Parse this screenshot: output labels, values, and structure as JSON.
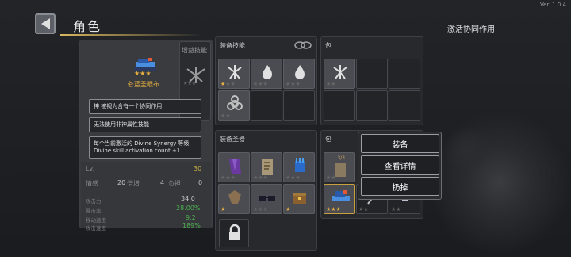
{
  "version": "Ver. 1.0.4",
  "header": {
    "title": "角色",
    "synergy_label": "激活协同作用"
  },
  "character": {
    "name": "苍蓝圣眼布",
    "sub_panel_title": "增益技能",
    "tooltip_1": "神 被视为含有一个协同作用",
    "tooltip_2": "无法使用非神属性技能",
    "tooltip_3": "每个当前激活的 Divine Synergy 等级, Divine skill activation count +1",
    "stars": 3,
    "level_label": "Lv.",
    "level_value": "30",
    "row2": {
      "a_label": "情感",
      "a_value": "20",
      "b_label": "倍增",
      "c_value": "4",
      "d_label": "负担",
      "e_value": "0"
    },
    "stats": [
      {
        "label": "攻击力",
        "value": "34.0",
        "color": "#c8c8c8"
      },
      {
        "label": "暴击率",
        "value": "28.00%",
        "color": "#4caf50"
      },
      {
        "label": "移动速度",
        "value": "9.2",
        "color": "#4caf50"
      },
      {
        "label": "攻击速度",
        "value": "189%",
        "color": "#4caf50"
      }
    ]
  },
  "equipped_skills": {
    "title": "装备技能",
    "slots": [
      {
        "icon": "dragon-skull-icon",
        "stars": 3
      },
      {
        "icon": "flame-icon",
        "stars": 3
      },
      {
        "icon": "flame-icon",
        "stars": 3
      },
      {
        "icon": "biohazard-icon",
        "stars": 2
      }
    ]
  },
  "skill_bag": {
    "title": "包",
    "slots": [
      {
        "icon": "dragon-skull-icon",
        "stars": 2
      }
    ]
  },
  "equipped_relics": {
    "title": "装备圣器",
    "slots": [
      {
        "icon": "purple-cloak-icon",
        "stars": 3
      },
      {
        "icon": "scroll-icon",
        "stars": 3
      },
      {
        "icon": "blue-gauntlet-icon",
        "stars": 3
      },
      {
        "icon": "bone-shield-icon",
        "stars": 1
      },
      {
        "icon": "sunglasses-icon",
        "stars": 3
      },
      {
        "icon": "treasure-chest-icon",
        "stars": 1
      }
    ]
  },
  "relic_bag": {
    "title": "包",
    "slots": [
      {
        "icon": "card-icon",
        "stars": 2,
        "count": "3/3"
      },
      {
        "icon": "rainbow-hat-icon",
        "stars": 3
      },
      {
        "icon": "feather-icon",
        "stars": 2
      },
      {
        "icon": "silver-badge-icon",
        "stars": 2
      }
    ]
  },
  "menu": {
    "equip": "装备",
    "details": "查看详情",
    "discard": "扔掉"
  },
  "colors": {
    "accent_gold": "#e8b040",
    "panel": "#28292e",
    "green": "#4caf50"
  }
}
